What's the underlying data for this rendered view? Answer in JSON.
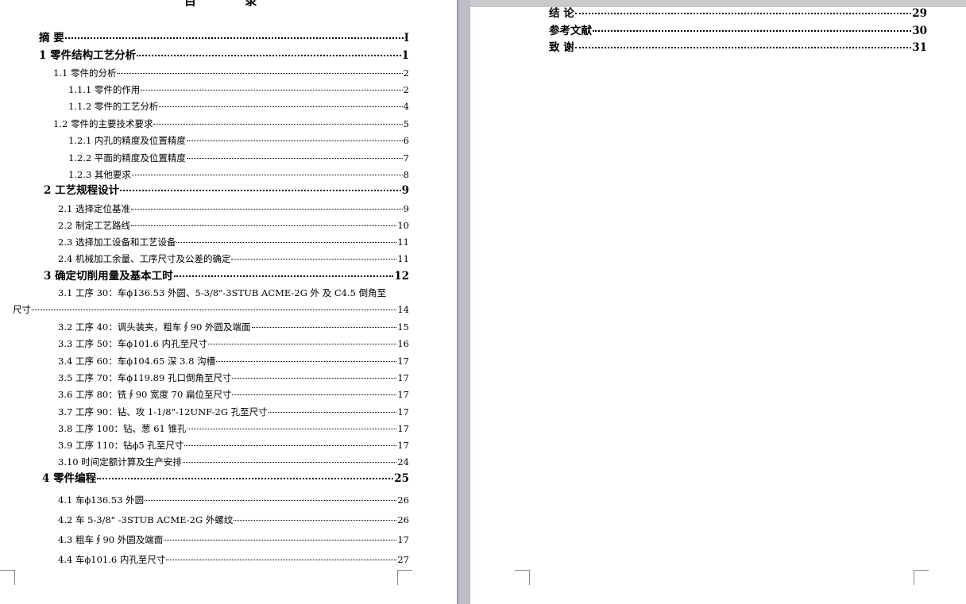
{
  "doc_title": "目 录",
  "toc_left": [
    {
      "text": "摘 要",
      "page": "I"
    },
    {
      "text": "1 零件结构工艺分析",
      "page": "1"
    },
    {
      "text": "1.1 零件的分析",
      "page": "2"
    },
    {
      "text": "1.1.1 零件的作用",
      "page": "2"
    },
    {
      "text": "1.1.2 零件的工艺分析",
      "page": "4"
    },
    {
      "text": "1.2 零件的主要技术要求",
      "page": "5"
    },
    {
      "text": "1.2.1 内孔的精度及位置精度",
      "page": "6"
    },
    {
      "text": "1.2.2 平面的精度及位置精度",
      "page": "7"
    },
    {
      "text": "1.2.3 其他要求",
      "page": "8"
    },
    {
      "text": "2 工艺规程设计",
      "page": "9"
    },
    {
      "text": "2.1 选择定位基准",
      "page": "9"
    },
    {
      "text": "2.2 制定工艺路线",
      "page": "10"
    },
    {
      "text": "2.3 选择加工设备和工艺设备",
      "page": "11"
    },
    {
      "text": "2.4 机械加工余量、工序尺寸及公差的确定",
      "page": "11"
    },
    {
      "text": "3 确定切削用量及基本工时",
      "page": "12"
    },
    {
      "text": "3.1 工序 30：车ϕ136.53 外圆、5-3/8\"-3STUB ACME-2G 外 及 C4.5 倒角至",
      "text2": "尺寸",
      "page": "14"
    },
    {
      "text": "3.2 工序 40：调头装夹，粗车∮90 外圆及端面",
      "page": "15"
    },
    {
      "text": "3.3 工序 50：车ϕ101.6 内孔至尺寸",
      "page": "16"
    },
    {
      "text": "3.4 工序 60：车ϕ104.65 深 3.8 沟槽",
      "page": "17"
    },
    {
      "text": "3.5 工序 70：车ϕ119.89 孔口倒角至尺寸",
      "page": "17"
    },
    {
      "text": "3.6 工序 80：铣∮90 宽度 70 扁位至尺寸",
      "page": "17"
    },
    {
      "text": "3.7 工序 90：钻、攻 1-1/8\"-12UNF-2G 孔至尺寸",
      "page": "17"
    },
    {
      "text": "3.8 工序 100：钻、葱 61 锥孔",
      "page": "17"
    },
    {
      "text": "3.9 工序 110：钻ϕ5 孔至尺寸",
      "page": "17"
    },
    {
      "text": "3.10 时间定额计算及生产安排",
      "page": "24"
    },
    {
      "text": "4 零件编程",
      "page": "25"
    },
    {
      "text": "4.1 车ϕ136.53 外圆",
      "page": "26"
    },
    {
      "text": "4.2 车 5-3/8\" -3STUB ACME-2G 外螺纹",
      "page": "26"
    },
    {
      "text": "4.3 粗车∮90 外圆及端面",
      "page": "17"
    },
    {
      "text": "4.4 车ϕ101.6 内孔至尺寸",
      "page": "27"
    }
  ],
  "toc_right": [
    {
      "text": "结 论",
      "page": "29"
    },
    {
      "text": "参考文献",
      "page": "30"
    },
    {
      "text": "致 谢",
      "page": "31"
    }
  ]
}
